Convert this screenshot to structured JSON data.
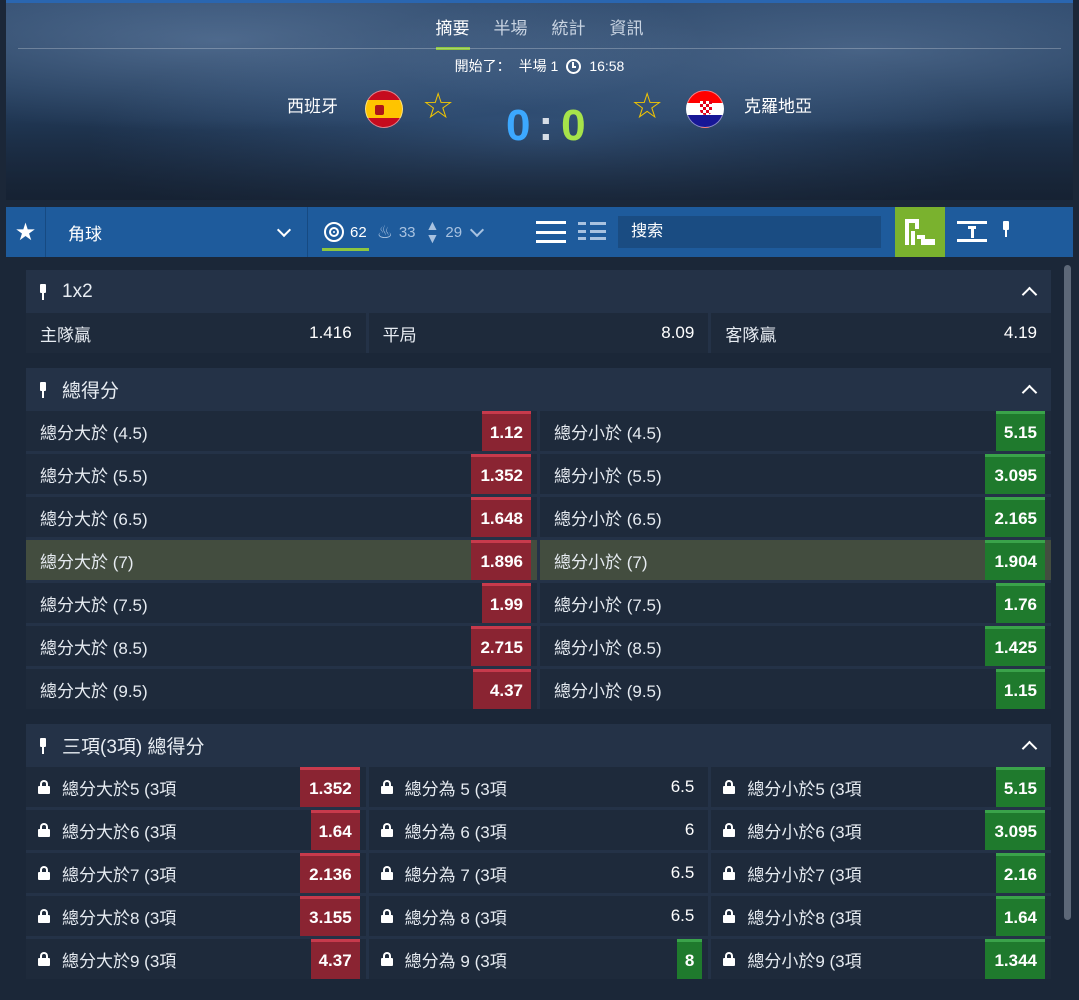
{
  "tabs": [
    "摘要",
    "半場",
    "統計",
    "資訊"
  ],
  "status": {
    "label": "開始了：",
    "period": "半場 1",
    "time": "16:58"
  },
  "home_team": "西班牙",
  "away_team": "克羅地亞",
  "score": {
    "home": "0",
    "sep": ":",
    "away": "0"
  },
  "toolbar": {
    "market_select": "角球",
    "counts": {
      "all": "62",
      "hot": "33",
      "updown": "29"
    },
    "search_placeholder": "搜索"
  },
  "panels": [
    {
      "title": "1x2",
      "rows": [
        [
          {
            "label": "主隊贏",
            "odd": "1.416"
          },
          {
            "label": "平局",
            "odd": "8.09"
          },
          {
            "label": "客隊贏",
            "odd": "4.19"
          }
        ]
      ]
    },
    {
      "title": "總得分",
      "rows": [
        [
          {
            "label": "總分大於 (4.5)",
            "odd": "1.12"
          },
          {
            "label": "總分小於 (4.5)",
            "odd": "5.15"
          }
        ],
        [
          {
            "label": "總分大於 (5.5)",
            "odd": "1.352"
          },
          {
            "label": "總分小於 (5.5)",
            "odd": "3.095"
          }
        ],
        [
          {
            "label": "總分大於 (6.5)",
            "odd": "1.648"
          },
          {
            "label": "總分小於 (6.5)",
            "odd": "2.165"
          }
        ],
        [
          {
            "label": "總分大於 (7)",
            "odd": "1.896"
          },
          {
            "label": "總分小於 (7)",
            "odd": "1.904"
          }
        ],
        [
          {
            "label": "總分大於 (7.5)",
            "odd": "1.99"
          },
          {
            "label": "總分小於 (7.5)",
            "odd": "1.76"
          }
        ],
        [
          {
            "label": "總分大於 (8.5)",
            "odd": "2.715"
          },
          {
            "label": "總分小於 (8.5)",
            "odd": "1.425"
          }
        ],
        [
          {
            "label": "總分大於 (9.5)",
            "odd": "4.37"
          },
          {
            "label": "總分小於 (9.5)",
            "odd": "1.15"
          }
        ]
      ]
    },
    {
      "title": "三項(3項) 總得分",
      "rows": [
        [
          {
            "label": "總分大於5 (3項",
            "odd": "1.352"
          },
          {
            "label": "總分為 5 (3項",
            "odd": "6.5"
          },
          {
            "label": "總分小於5 (3項",
            "odd": "5.15"
          }
        ],
        [
          {
            "label": "總分大於6 (3項",
            "odd": "1.64"
          },
          {
            "label": "總分為 6 (3項",
            "odd": "6"
          },
          {
            "label": "總分小於6 (3項",
            "odd": "3.095"
          }
        ],
        [
          {
            "label": "總分大於7 (3項",
            "odd": "2.136"
          },
          {
            "label": "總分為 7 (3項",
            "odd": "6.5"
          },
          {
            "label": "總分小於7 (3項",
            "odd": "2.16"
          }
        ],
        [
          {
            "label": "總分大於8 (3項",
            "odd": "3.155"
          },
          {
            "label": "總分為 8 (3項",
            "odd": "6.5"
          },
          {
            "label": "總分小於8 (3項",
            "odd": "1.64"
          }
        ],
        [
          {
            "label": "總分大於9 (3項",
            "odd": "4.37"
          },
          {
            "label": "總分為 9 (3項",
            "odd": "8"
          },
          {
            "label": "總分小於9 (3項",
            "odd": "1.344"
          }
        ]
      ]
    }
  ],
  "colors": {
    "accent_green": "#8dc63f",
    "odd_red": "#8a2432",
    "odd_green": "#1f7a2d",
    "bar_blue": "#1e5b9c"
  },
  "icons": [
    "star-icon",
    "target-icon",
    "flame-icon",
    "updown-icon",
    "list-view-icon",
    "grid-view-icon",
    "stadium-icon",
    "collapse-icon",
    "pin-icon",
    "lock-icon",
    "clock-icon",
    "chevron-up-icon"
  ]
}
